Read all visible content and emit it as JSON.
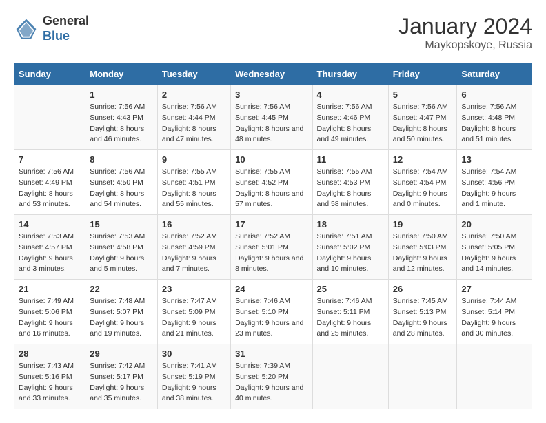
{
  "logo": {
    "general": "General",
    "blue": "Blue"
  },
  "header": {
    "month": "January 2024",
    "location": "Maykopskoye, Russia"
  },
  "weekdays": [
    "Sunday",
    "Monday",
    "Tuesday",
    "Wednesday",
    "Thursday",
    "Friday",
    "Saturday"
  ],
  "weeks": [
    [
      {
        "day": "",
        "sunrise": "",
        "sunset": "",
        "daylight": ""
      },
      {
        "day": "1",
        "sunrise": "Sunrise: 7:56 AM",
        "sunset": "Sunset: 4:43 PM",
        "daylight": "Daylight: 8 hours and 46 minutes."
      },
      {
        "day": "2",
        "sunrise": "Sunrise: 7:56 AM",
        "sunset": "Sunset: 4:44 PM",
        "daylight": "Daylight: 8 hours and 47 minutes."
      },
      {
        "day": "3",
        "sunrise": "Sunrise: 7:56 AM",
        "sunset": "Sunset: 4:45 PM",
        "daylight": "Daylight: 8 hours and 48 minutes."
      },
      {
        "day": "4",
        "sunrise": "Sunrise: 7:56 AM",
        "sunset": "Sunset: 4:46 PM",
        "daylight": "Daylight: 8 hours and 49 minutes."
      },
      {
        "day": "5",
        "sunrise": "Sunrise: 7:56 AM",
        "sunset": "Sunset: 4:47 PM",
        "daylight": "Daylight: 8 hours and 50 minutes."
      },
      {
        "day": "6",
        "sunrise": "Sunrise: 7:56 AM",
        "sunset": "Sunset: 4:48 PM",
        "daylight": "Daylight: 8 hours and 51 minutes."
      }
    ],
    [
      {
        "day": "7",
        "sunrise": "Sunrise: 7:56 AM",
        "sunset": "Sunset: 4:49 PM",
        "daylight": "Daylight: 8 hours and 53 minutes."
      },
      {
        "day": "8",
        "sunrise": "Sunrise: 7:56 AM",
        "sunset": "Sunset: 4:50 PM",
        "daylight": "Daylight: 8 hours and 54 minutes."
      },
      {
        "day": "9",
        "sunrise": "Sunrise: 7:55 AM",
        "sunset": "Sunset: 4:51 PM",
        "daylight": "Daylight: 8 hours and 55 minutes."
      },
      {
        "day": "10",
        "sunrise": "Sunrise: 7:55 AM",
        "sunset": "Sunset: 4:52 PM",
        "daylight": "Daylight: 8 hours and 57 minutes."
      },
      {
        "day": "11",
        "sunrise": "Sunrise: 7:55 AM",
        "sunset": "Sunset: 4:53 PM",
        "daylight": "Daylight: 8 hours and 58 minutes."
      },
      {
        "day": "12",
        "sunrise": "Sunrise: 7:54 AM",
        "sunset": "Sunset: 4:54 PM",
        "daylight": "Daylight: 9 hours and 0 minutes."
      },
      {
        "day": "13",
        "sunrise": "Sunrise: 7:54 AM",
        "sunset": "Sunset: 4:56 PM",
        "daylight": "Daylight: 9 hours and 1 minute."
      }
    ],
    [
      {
        "day": "14",
        "sunrise": "Sunrise: 7:53 AM",
        "sunset": "Sunset: 4:57 PM",
        "daylight": "Daylight: 9 hours and 3 minutes."
      },
      {
        "day": "15",
        "sunrise": "Sunrise: 7:53 AM",
        "sunset": "Sunset: 4:58 PM",
        "daylight": "Daylight: 9 hours and 5 minutes."
      },
      {
        "day": "16",
        "sunrise": "Sunrise: 7:52 AM",
        "sunset": "Sunset: 4:59 PM",
        "daylight": "Daylight: 9 hours and 7 minutes."
      },
      {
        "day": "17",
        "sunrise": "Sunrise: 7:52 AM",
        "sunset": "Sunset: 5:01 PM",
        "daylight": "Daylight: 9 hours and 8 minutes."
      },
      {
        "day": "18",
        "sunrise": "Sunrise: 7:51 AM",
        "sunset": "Sunset: 5:02 PM",
        "daylight": "Daylight: 9 hours and 10 minutes."
      },
      {
        "day": "19",
        "sunrise": "Sunrise: 7:50 AM",
        "sunset": "Sunset: 5:03 PM",
        "daylight": "Daylight: 9 hours and 12 minutes."
      },
      {
        "day": "20",
        "sunrise": "Sunrise: 7:50 AM",
        "sunset": "Sunset: 5:05 PM",
        "daylight": "Daylight: 9 hours and 14 minutes."
      }
    ],
    [
      {
        "day": "21",
        "sunrise": "Sunrise: 7:49 AM",
        "sunset": "Sunset: 5:06 PM",
        "daylight": "Daylight: 9 hours and 16 minutes."
      },
      {
        "day": "22",
        "sunrise": "Sunrise: 7:48 AM",
        "sunset": "Sunset: 5:07 PM",
        "daylight": "Daylight: 9 hours and 19 minutes."
      },
      {
        "day": "23",
        "sunrise": "Sunrise: 7:47 AM",
        "sunset": "Sunset: 5:09 PM",
        "daylight": "Daylight: 9 hours and 21 minutes."
      },
      {
        "day": "24",
        "sunrise": "Sunrise: 7:46 AM",
        "sunset": "Sunset: 5:10 PM",
        "daylight": "Daylight: 9 hours and 23 minutes."
      },
      {
        "day": "25",
        "sunrise": "Sunrise: 7:46 AM",
        "sunset": "Sunset: 5:11 PM",
        "daylight": "Daylight: 9 hours and 25 minutes."
      },
      {
        "day": "26",
        "sunrise": "Sunrise: 7:45 AM",
        "sunset": "Sunset: 5:13 PM",
        "daylight": "Daylight: 9 hours and 28 minutes."
      },
      {
        "day": "27",
        "sunrise": "Sunrise: 7:44 AM",
        "sunset": "Sunset: 5:14 PM",
        "daylight": "Daylight: 9 hours and 30 minutes."
      }
    ],
    [
      {
        "day": "28",
        "sunrise": "Sunrise: 7:43 AM",
        "sunset": "Sunset: 5:16 PM",
        "daylight": "Daylight: 9 hours and 33 minutes."
      },
      {
        "day": "29",
        "sunrise": "Sunrise: 7:42 AM",
        "sunset": "Sunset: 5:17 PM",
        "daylight": "Daylight: 9 hours and 35 minutes."
      },
      {
        "day": "30",
        "sunrise": "Sunrise: 7:41 AM",
        "sunset": "Sunset: 5:19 PM",
        "daylight": "Daylight: 9 hours and 38 minutes."
      },
      {
        "day": "31",
        "sunrise": "Sunrise: 7:39 AM",
        "sunset": "Sunset: 5:20 PM",
        "daylight": "Daylight: 9 hours and 40 minutes."
      },
      {
        "day": "",
        "sunrise": "",
        "sunset": "",
        "daylight": ""
      },
      {
        "day": "",
        "sunrise": "",
        "sunset": "",
        "daylight": ""
      },
      {
        "day": "",
        "sunrise": "",
        "sunset": "",
        "daylight": ""
      }
    ]
  ]
}
